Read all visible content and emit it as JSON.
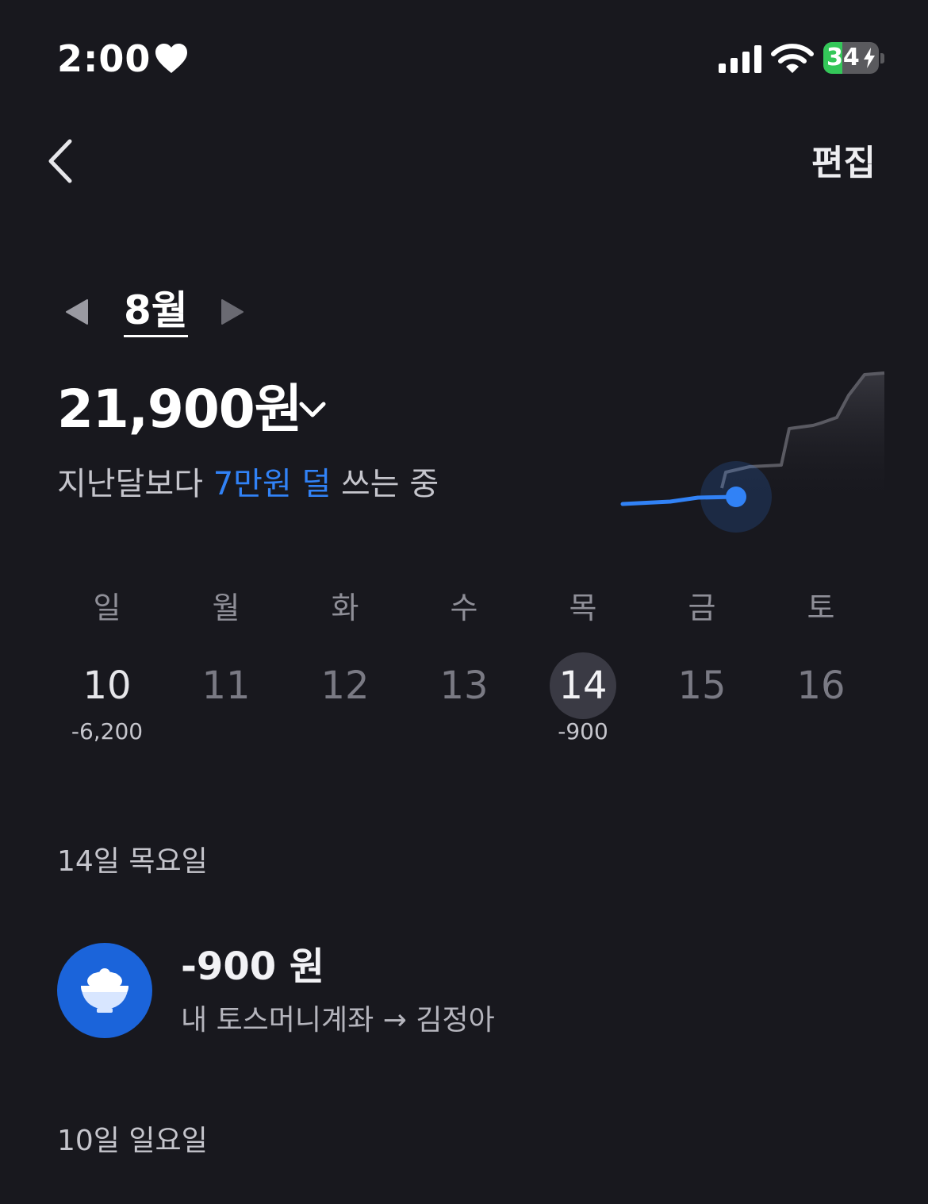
{
  "status_bar": {
    "time": "2:00",
    "battery": "34",
    "battery_level": 0.34
  },
  "nav": {
    "edit_label": "편집"
  },
  "month": {
    "label": "8월"
  },
  "summary": {
    "amount": "21,900원",
    "compare_prefix": "지난달보다 ",
    "compare_highlight": "7만원 덜",
    "compare_suffix": " 쓰는 중"
  },
  "week": {
    "days": [
      {
        "dow": "일",
        "num": "10",
        "amount": "-6,200"
      },
      {
        "dow": "월",
        "num": "11",
        "amount": ""
      },
      {
        "dow": "화",
        "num": "12",
        "amount": ""
      },
      {
        "dow": "수",
        "num": "13",
        "amount": ""
      },
      {
        "dow": "목",
        "num": "14",
        "amount": "-900"
      },
      {
        "dow": "금",
        "num": "15",
        "amount": ""
      },
      {
        "dow": "토",
        "num": "16",
        "amount": ""
      }
    ]
  },
  "sections": [
    {
      "heading": "14일 목요일",
      "transactions": [
        {
          "amount": "-900 원",
          "description": "내 토스머니계좌 → 김정아",
          "icon": "rice-bowl-icon"
        }
      ]
    },
    {
      "heading": "10일 일요일",
      "transactions": []
    }
  ],
  "colors": {
    "background": "#18181e",
    "accent": "#3182f6",
    "icon_bg": "#1b64da",
    "selected_day_bg": "#3a3a44"
  }
}
